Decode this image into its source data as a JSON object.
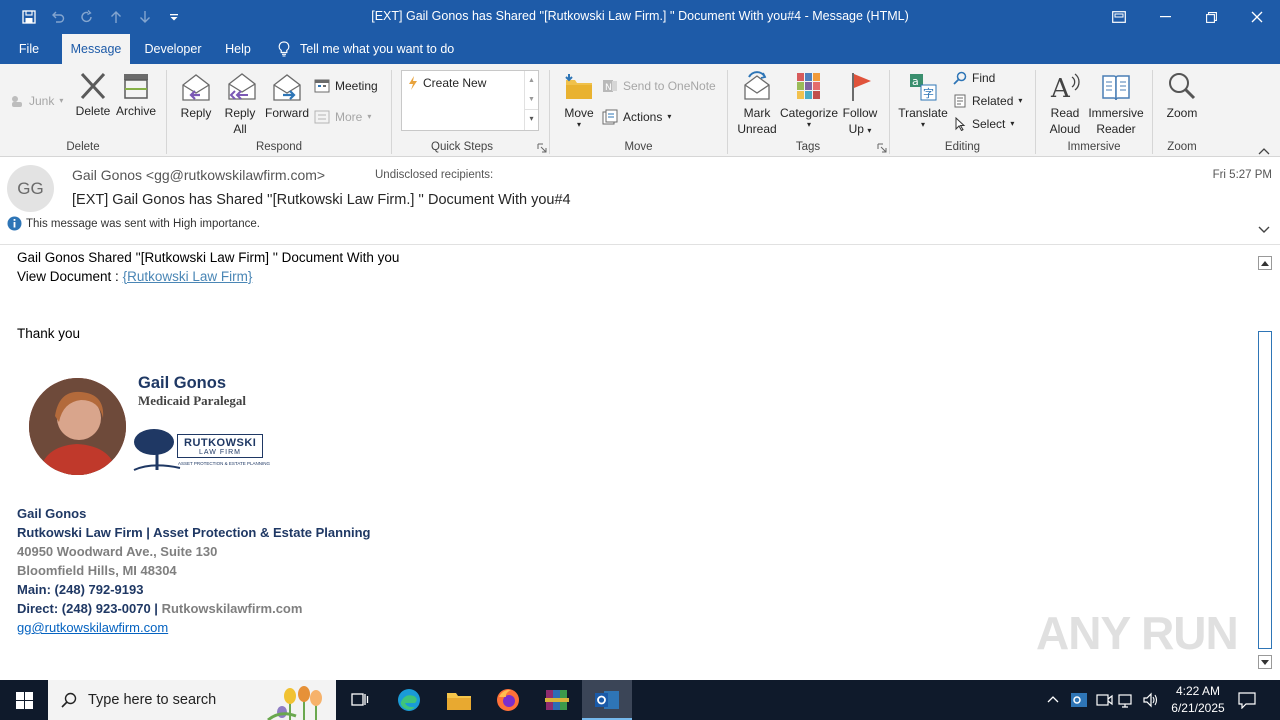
{
  "window": {
    "title": "[EXT] Gail Gonos has Shared ''[Rutkowski Law Firm.] '' Document With you#4  -  Message (HTML)"
  },
  "menu": {
    "tabs": [
      "File",
      "Message",
      "Developer",
      "Help"
    ],
    "active_tab": "Message",
    "tell_me": "Tell me what you want to do"
  },
  "ribbon": {
    "delete_group": {
      "junk": "Junk",
      "delete": "Delete",
      "archive": "Archive",
      "label": "Delete"
    },
    "respond_group": {
      "reply": "Reply",
      "reply_all_1": "Reply",
      "reply_all_2": "All",
      "forward": "Forward",
      "meeting": "Meeting",
      "more": "More",
      "label": "Respond"
    },
    "quick_steps": {
      "create_new": "Create New",
      "label": "Quick Steps"
    },
    "move_group": {
      "move": "Move",
      "onenote": "Send to OneNote",
      "actions": "Actions",
      "label": "Move"
    },
    "tags_group": {
      "mark_1": "Mark",
      "mark_2": "Unread",
      "categorize": "Categorize",
      "follow_1": "Follow",
      "follow_2": "Up",
      "label": "Tags"
    },
    "editing_group": {
      "translate": "Translate",
      "find": "Find",
      "related": "Related",
      "select": "Select",
      "label": "Editing"
    },
    "immersive_group": {
      "read_1": "Read",
      "read_2": "Aloud",
      "imm_1": "Immersive",
      "imm_2": "Reader",
      "label": "Immersive"
    },
    "zoom_group": {
      "zoom": "Zoom",
      "label": "Zoom"
    }
  },
  "header": {
    "avatar_initials": "GG",
    "sender": "Gail Gonos <gg@rutkowskilawfirm.com>",
    "recipients": "Undisclosed recipients:",
    "date": "Fri 5:27 PM",
    "subject": "[EXT] Gail Gonos has Shared ''[Rutkowski Law Firm.] '' Document With you#4",
    "importance": "This message was sent with High importance."
  },
  "body": {
    "line1": "Gail Gonos Shared ''[Rutkowski Law Firm] '' Document With you",
    "view_label": "View Document : ",
    "view_link": "{Rutkowski Law Firm}",
    "thanks": "Thank you",
    "card_name": "Gail Gonos",
    "card_title": "Medicaid Paralegal",
    "logo_text": "RUTKOWSKI",
    "logo_sub": "LAW FIRM",
    "logo_tag": "ASSET PROTECTION & ESTATE PLANNING",
    "sig_name": "Gail Gonos",
    "sig_firm": "Rutkowski Law Firm | Asset Protection & Estate Planning",
    "sig_addr1": "40950 Woodward Ave., Suite 130",
    "sig_addr2": "Bloomfield Hills, MI 48304",
    "sig_main": "Main: (248) 792-9193",
    "sig_direct": "Direct: (248) 923-0070 | ",
    "sig_site": "Rutkowskilawfirm.com",
    "sig_email": "gg@rutkowskilawfirm.com"
  },
  "watermark": "ANY RUN",
  "taskbar": {
    "search_placeholder": "Type here to search",
    "time": "4:22 AM",
    "date": "6/21/2025"
  },
  "colors": {
    "title_blue": "#1e5ba8",
    "link": "#0563c1",
    "sig_blue": "#1f3864",
    "taskbar": "#0f1a2b"
  }
}
